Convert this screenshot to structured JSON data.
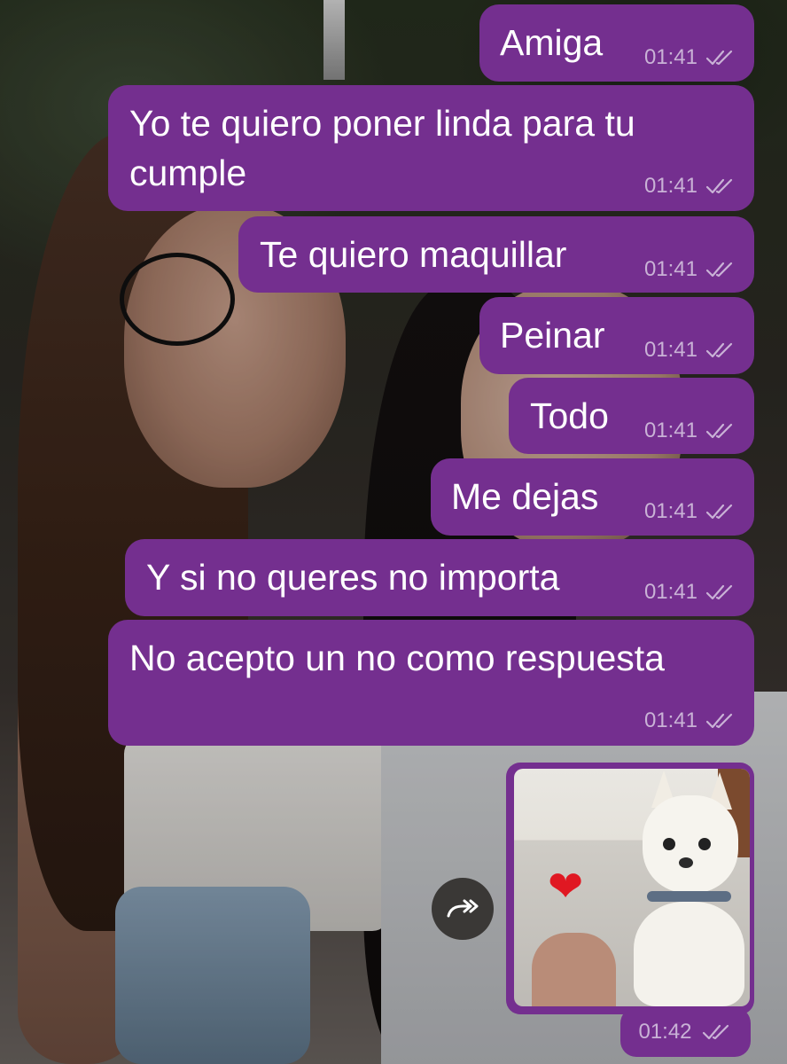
{
  "chat": {
    "messages": [
      {
        "text": "Amiga",
        "time": "01:41",
        "status": "read"
      },
      {
        "text": "Yo te quiero poner linda para tu cumple",
        "time": "01:41",
        "status": "read"
      },
      {
        "text": "Te quiero maquillar",
        "time": "01:41",
        "status": "read"
      },
      {
        "text": "Peinar",
        "time": "01:41",
        "status": "read"
      },
      {
        "text": "Todo",
        "time": "01:41",
        "status": "read"
      },
      {
        "text": "Me dejas",
        "time": "01:41",
        "status": "read"
      },
      {
        "text": "Y si no queres no importa",
        "time": "01:41",
        "status": "read"
      },
      {
        "text": "No acepto un no como respuesta",
        "time": "01:41",
        "status": "read"
      }
    ],
    "media_message": {
      "type": "sticker-image",
      "depicts": "chihuahua-heart",
      "time": "01:42",
      "status": "read"
    }
  },
  "icons": {
    "read_ticks": "double-check-icon",
    "forward": "forward-icon",
    "heart": "heart-icon"
  },
  "colors": {
    "bubble": "#742f8f",
    "meta_text": "#c9b2d6",
    "text": "#ffffff",
    "forward_button": "#3a3836"
  }
}
